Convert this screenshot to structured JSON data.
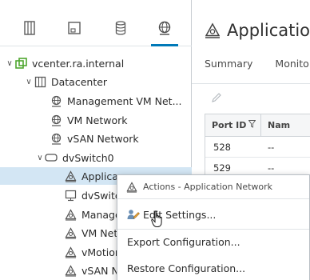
{
  "navigator": {
    "tabs": [
      {
        "name": "hosts-clusters-icon"
      },
      {
        "name": "vms-templates-icon"
      },
      {
        "name": "storage-icon"
      },
      {
        "name": "networking-icon"
      }
    ],
    "tree": [
      {
        "label": "vcenter.ra.internal",
        "icon": "vcenter-icon",
        "caret": "∨"
      },
      {
        "label": "Datacenter",
        "icon": "datacenter-icon",
        "caret": "∨"
      },
      {
        "label": "Management VM Net...",
        "icon": "network-icon"
      },
      {
        "label": "VM Network",
        "icon": "network-icon"
      },
      {
        "label": "vSAN Network",
        "icon": "network-icon"
      },
      {
        "label": "dvSwitch0",
        "icon": "dvswitch-icon",
        "caret": "∨"
      },
      {
        "label": "Applica",
        "icon": "portgroup-icon"
      },
      {
        "label": "dvSwitc",
        "icon": "uplink-icon"
      },
      {
        "label": "Manage",
        "icon": "portgroup-icon"
      },
      {
        "label": "VM Net",
        "icon": "portgroup-icon"
      },
      {
        "label": "vMotion",
        "icon": "portgroup-icon"
      },
      {
        "label": "vSAN N",
        "icon": "portgroup-icon"
      }
    ]
  },
  "content": {
    "title": "Applicatio",
    "tabs": [
      "Summary",
      "Monito"
    ],
    "table": {
      "headers": [
        "Port ID",
        "Nam"
      ],
      "rows": [
        [
          "528",
          "--"
        ],
        [
          "529",
          "--"
        ]
      ]
    }
  },
  "context_menu": {
    "header": "Actions - Application Network",
    "items": [
      "Edit Settings...",
      "Export Configuration...",
      "Restore Configuration..."
    ]
  },
  "colors": {
    "accent": "#0079b8",
    "selection": "#d3e6f4",
    "vcenter_green": "#4ea72e"
  }
}
